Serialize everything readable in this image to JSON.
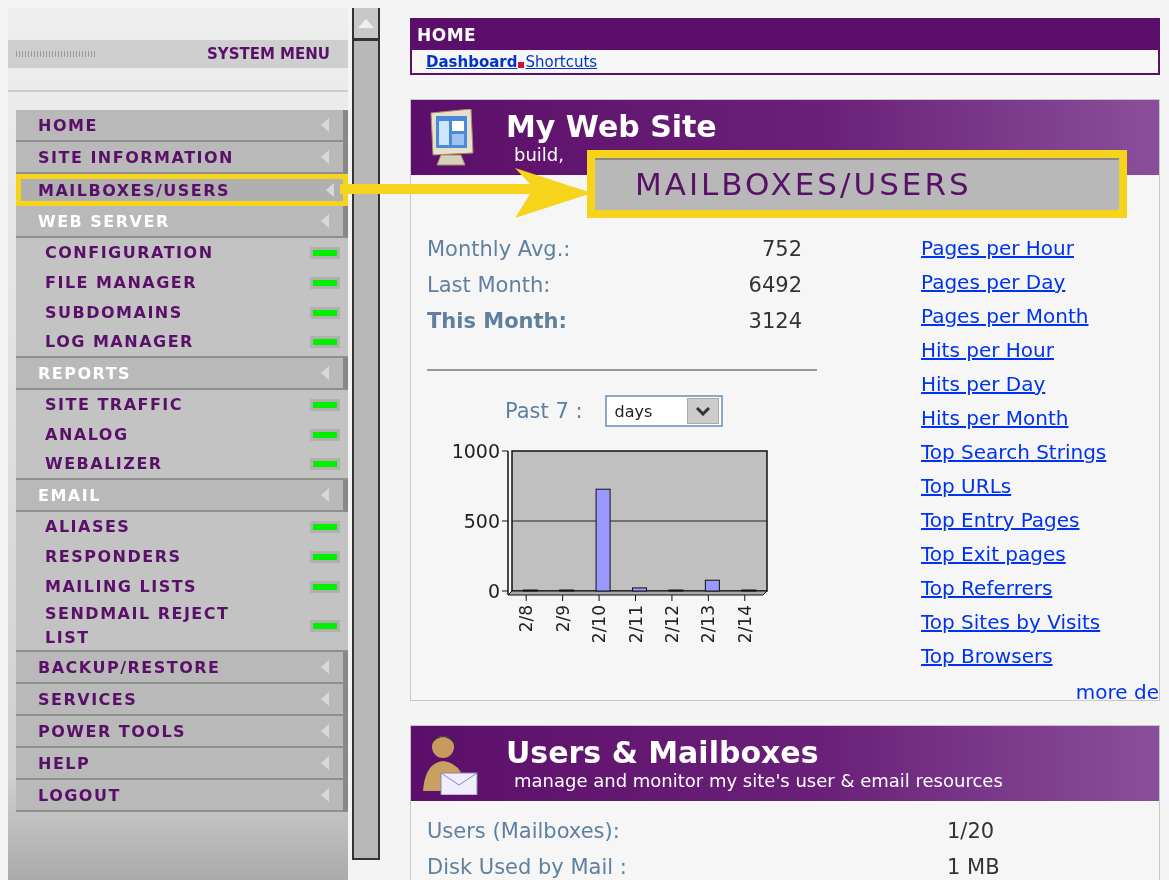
{
  "sidebar": {
    "title": "SYSTEM MENU",
    "items": [
      {
        "kind": "item",
        "label": "HOME",
        "selected": false
      },
      {
        "kind": "item",
        "label": "SITE INFORMATION",
        "selected": false
      },
      {
        "kind": "item",
        "label": "MAILBOXES/USERS",
        "selected": true
      },
      {
        "kind": "section",
        "label": "WEB SERVER",
        "selected": false
      },
      {
        "kind": "sub",
        "label": "CONFIGURATION",
        "selected": false
      },
      {
        "kind": "sub",
        "label": "FILE MANAGER",
        "selected": false
      },
      {
        "kind": "sub",
        "label": "SUBDOMAINS",
        "selected": false
      },
      {
        "kind": "sub",
        "label": "LOG MANAGER",
        "selected": false
      },
      {
        "kind": "section",
        "label": "REPORTS",
        "selected": false
      },
      {
        "kind": "sub",
        "label": "SITE TRAFFIC",
        "selected": false
      },
      {
        "kind": "sub",
        "label": "ANALOG",
        "selected": false
      },
      {
        "kind": "sub",
        "label": "WEBALIZER",
        "selected": false
      },
      {
        "kind": "section",
        "label": "EMAIL",
        "selected": false
      },
      {
        "kind": "sub",
        "label": "ALIASES",
        "selected": false
      },
      {
        "kind": "sub",
        "label": "RESPONDERS",
        "selected": false
      },
      {
        "kind": "sub",
        "label": "MAILING LISTS",
        "selected": false
      },
      {
        "kind": "sub",
        "label": "SENDMAIL REJECT LIST",
        "selected": false
      },
      {
        "kind": "item",
        "label": "BACKUP/RESTORE",
        "selected": false
      },
      {
        "kind": "item",
        "label": "SERVICES",
        "selected": false
      },
      {
        "kind": "item",
        "label": "POWER TOOLS",
        "selected": false
      },
      {
        "kind": "item",
        "label": "HELP",
        "selected": false
      },
      {
        "kind": "item",
        "label": "LOGOUT",
        "selected": false
      }
    ]
  },
  "header": {
    "title": "HOME",
    "tabs": [
      {
        "label": "Dashboard",
        "selected": true
      },
      {
        "label": "Shortcuts",
        "selected": false
      }
    ]
  },
  "site_card": {
    "title": "My Web Site",
    "subtitle": "build,",
    "stats": [
      {
        "label": "Monthly Avg.:",
        "value": "752",
        "bold": false
      },
      {
        "label": "Last Month:",
        "value": "6492",
        "bold": false
      },
      {
        "label": "This Month:",
        "value": "3124",
        "bold": true
      }
    ],
    "range_label": "Past 7 :",
    "range_select": {
      "value": "days"
    },
    "chart_data": {
      "type": "bar",
      "categories": [
        "2/8",
        "2/9",
        "2/10",
        "2/11",
        "2/12",
        "2/13",
        "2/14"
      ],
      "values": [
        0,
        0,
        720,
        15,
        0,
        70,
        0
      ],
      "ylim": [
        0,
        1000
      ],
      "yticks": [
        0,
        500,
        1000
      ]
    },
    "links": [
      "Pages per Hour",
      "Pages per Day",
      "Pages per Month",
      "Hits per Hour",
      "Hits per Day",
      "Hits per Month",
      "Top Search Strings",
      "Top URLs",
      "Top Entry Pages",
      "Top Exit pages",
      "Top Referrers",
      "Top Sites by Visits",
      "Top Browsers"
    ],
    "more_link": "more de"
  },
  "users_card": {
    "title": "Users & Mailboxes",
    "subtitle": "manage and monitor my site's user & email resources",
    "rows": [
      {
        "label": "Users (Mailboxes):",
        "value": "1/20"
      },
      {
        "label": "Disk Used by Mail :",
        "value": "1 MB"
      }
    ]
  },
  "callout": {
    "label": "MAILBOXES/USERS"
  }
}
